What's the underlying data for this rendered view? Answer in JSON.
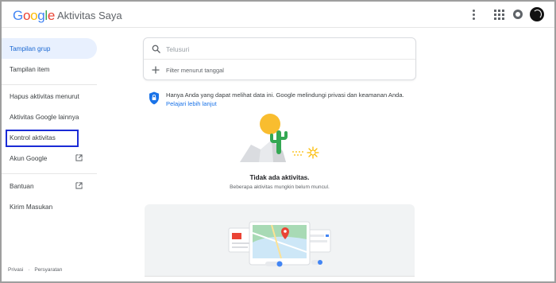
{
  "header": {
    "logo_letters": [
      {
        "ch": "G",
        "color": "#4285F4"
      },
      {
        "ch": "o",
        "color": "#EA4335"
      },
      {
        "ch": "o",
        "color": "#FBBC05"
      },
      {
        "ch": "g",
        "color": "#4285F4"
      },
      {
        "ch": "l",
        "color": "#34A853"
      },
      {
        "ch": "e",
        "color": "#EA4335"
      }
    ],
    "logo_text": "Google",
    "app_title": "Aktivitas Saya",
    "icons": [
      "more-vert-icon",
      "apps-grid-icon",
      "account-badge-icon",
      "avatar"
    ]
  },
  "sidebar": {
    "items": [
      {
        "label": "Tampilan grup",
        "active": true
      },
      {
        "label": "Tampilan item",
        "active": false
      },
      {
        "label": "Hapus aktivitas menurut",
        "active": false
      },
      {
        "label": "Aktivitas Google lainnya",
        "active": false
      },
      {
        "label": "Kontrol aktivitas",
        "active": false,
        "highlighted": true
      },
      {
        "label": "Akun Google",
        "active": false,
        "external": true
      },
      {
        "label": "Bantuan",
        "active": false,
        "external": true
      },
      {
        "label": "Kirim Masukan",
        "active": false
      }
    ],
    "footer": {
      "privacy": "Privasi",
      "separator": "·",
      "terms": "Persyaratan"
    }
  },
  "search": {
    "placeholder": "Telusuri",
    "filter_label": "Filter menurut tanggal"
  },
  "privacy_notice": {
    "text": "Hanya Anda yang dapat melihat data ini. Google melindungi privasi dan keamanan Anda.",
    "link": "Pelajari lebih lanjut"
  },
  "empty_state": {
    "title": "Tidak ada aktivitas.",
    "subtitle": "Beberapa aktivitas mungkin belum muncul."
  },
  "colors": {
    "accent_blue": "#1a73e8",
    "active_bg": "#e8f0fe",
    "focus_outline": "#1a2bd6"
  }
}
